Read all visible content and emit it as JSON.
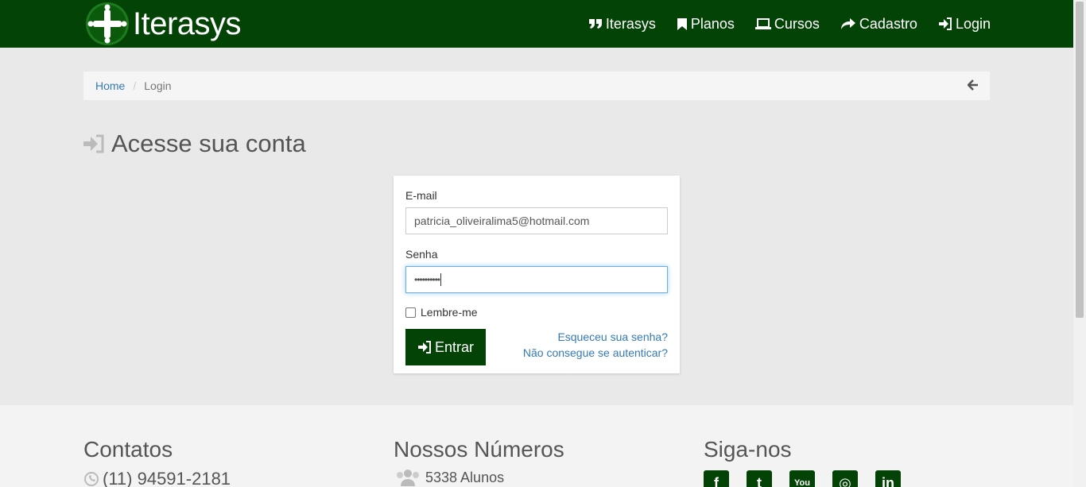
{
  "brand": {
    "name": "Iterasys",
    "accent": "#034306"
  },
  "nav": {
    "items": [
      {
        "label": "Iterasys",
        "icon": "quote-icon"
      },
      {
        "label": "Planos",
        "icon": "bookmark-icon"
      },
      {
        "label": "Cursos",
        "icon": "laptop-icon"
      },
      {
        "label": "Cadastro",
        "icon": "share-icon"
      },
      {
        "label": "Login",
        "icon": "sign-in-icon"
      }
    ]
  },
  "breadcrumb": {
    "home": "Home",
    "separator": "/",
    "current": "Login"
  },
  "page": {
    "title": "Acesse sua conta"
  },
  "form": {
    "email_label": "E-mail",
    "email_value": "patricia_oliveiralima5@hotmail.com",
    "password_label": "Senha",
    "password_value": "••••••••••",
    "remember_label": "Lembre-me",
    "submit_label": "Entrar",
    "forgot_link": "Esqueceu sua senha?",
    "auth_link": "Não consegue se autenticar?"
  },
  "footer": {
    "contacts_heading": "Contatos",
    "phone": "(11) 94591-2181",
    "numbers_heading": "Nossos Números",
    "students": "5338 Alunos",
    "follow_heading": "Siga-nos",
    "social": [
      {
        "name": "facebook-icon",
        "glyph": "f"
      },
      {
        "name": "twitter-icon",
        "glyph": "t"
      },
      {
        "name": "youtube-icon",
        "glyph": "You"
      },
      {
        "name": "instagram-icon",
        "glyph": "◎"
      },
      {
        "name": "linkedin-icon",
        "glyph": "in"
      }
    ]
  }
}
